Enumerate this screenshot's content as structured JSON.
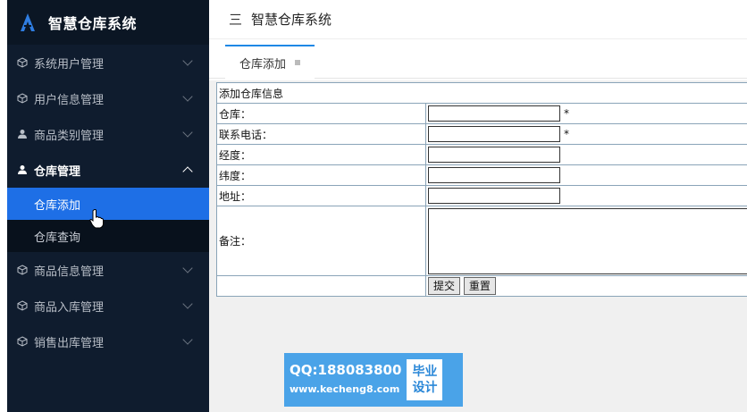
{
  "sidebar": {
    "brand": "智慧仓库系统",
    "items": [
      {
        "label": "系统用户管理"
      },
      {
        "label": "用户信息管理"
      },
      {
        "label": "商品类别管理"
      },
      {
        "label": "仓库管理",
        "sub": [
          "仓库添加",
          "仓库查询"
        ]
      },
      {
        "label": "商品信息管理"
      },
      {
        "label": "商品入库管理"
      },
      {
        "label": "销售出库管理"
      }
    ]
  },
  "header": {
    "title": "智慧仓库系统",
    "menu_icon": "三"
  },
  "tabs": [
    {
      "label": "仓库添加"
    }
  ],
  "form": {
    "caption": "添加仓库信息",
    "rows": [
      {
        "label": "仓库：",
        "required": "*"
      },
      {
        "label": "联系电话：",
        "required": "*"
      },
      {
        "label": "经度："
      },
      {
        "label": "纬度："
      },
      {
        "label": "地址："
      },
      {
        "label": "备注："
      }
    ],
    "submit": "提交",
    "reset": "重置"
  },
  "watermark": {
    "qq": "QQ:188083800",
    "url": "www.kecheng8.com",
    "badge_top": "毕业",
    "badge_bottom": "设计"
  }
}
